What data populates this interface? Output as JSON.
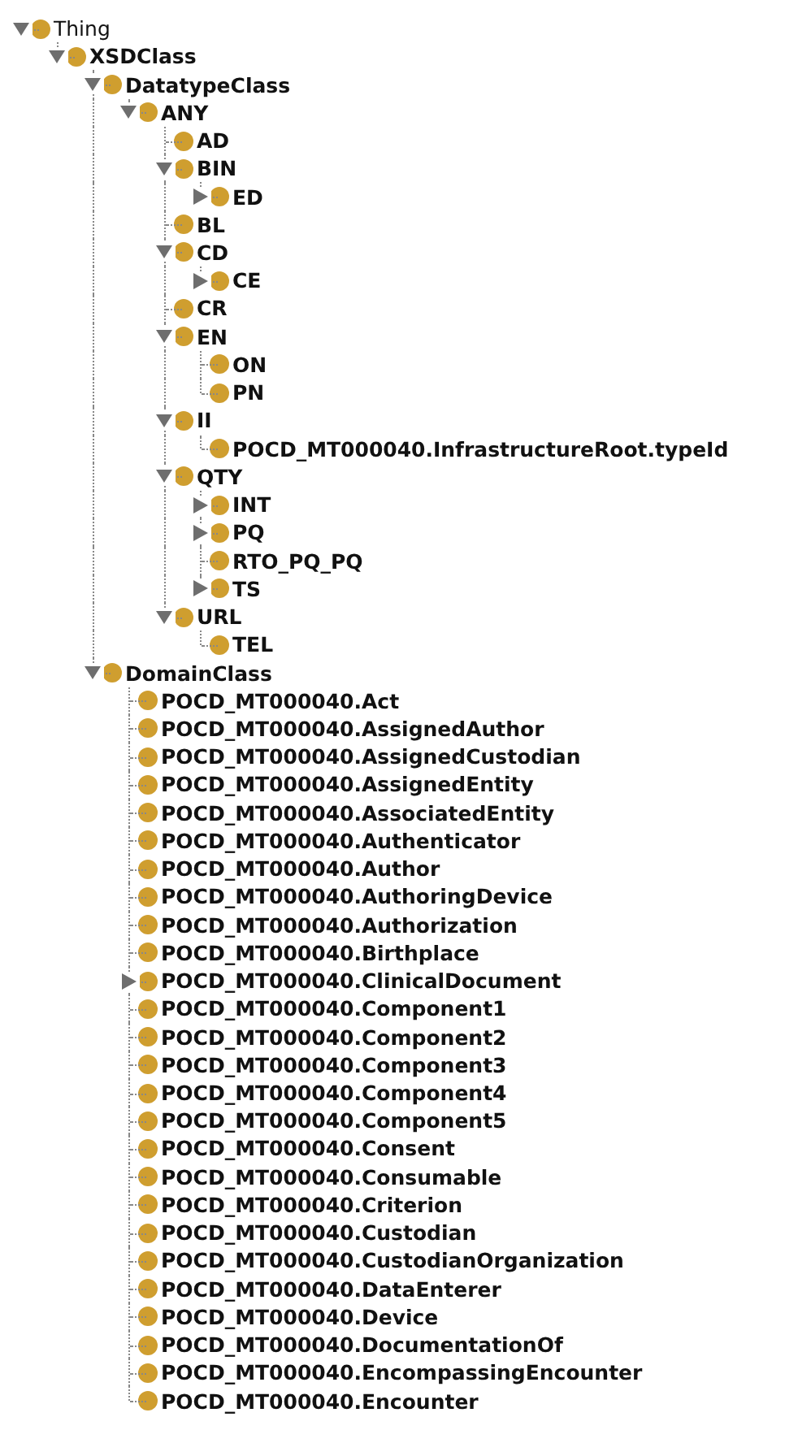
{
  "class_tree": [
    {
      "label": "Thing",
      "expanded": true,
      "children": [
        {
          "label": "XSDClass",
          "expanded": true,
          "children": [
            {
              "label": "DatatypeClass",
              "expanded": true,
              "children": [
                {
                  "label": "ANY",
                  "expanded": true,
                  "children": [
                    {
                      "label": "AD"
                    },
                    {
                      "label": "BIN",
                      "expanded": true,
                      "children": [
                        {
                          "label": "ED",
                          "expanded": false
                        }
                      ]
                    },
                    {
                      "label": "BL"
                    },
                    {
                      "label": "CD",
                      "expanded": true,
                      "children": [
                        {
                          "label": "CE",
                          "expanded": false
                        }
                      ]
                    },
                    {
                      "label": "CR"
                    },
                    {
                      "label": "EN",
                      "expanded": true,
                      "children": [
                        {
                          "label": "ON"
                        },
                        {
                          "label": "PN"
                        }
                      ]
                    },
                    {
                      "label": "II",
                      "expanded": true,
                      "children": [
                        {
                          "label": "POCD_MT000040.InfrastructureRoot.typeId"
                        }
                      ]
                    },
                    {
                      "label": "QTY",
                      "expanded": true,
                      "children": [
                        {
                          "label": "INT",
                          "expanded": false
                        },
                        {
                          "label": "PQ",
                          "expanded": false
                        },
                        {
                          "label": "RTO_PQ_PQ"
                        },
                        {
                          "label": "TS",
                          "expanded": false
                        }
                      ]
                    },
                    {
                      "label": "URL",
                      "expanded": true,
                      "children": [
                        {
                          "label": "TEL"
                        }
                      ]
                    }
                  ]
                }
              ]
            },
            {
              "label": "DomainClass",
              "expanded": true,
              "children": [
                {
                  "label": "POCD_MT000040.Act"
                },
                {
                  "label": "POCD_MT000040.AssignedAuthor"
                },
                {
                  "label": "POCD_MT000040.AssignedCustodian"
                },
                {
                  "label": "POCD_MT000040.AssignedEntity"
                },
                {
                  "label": "POCD_MT000040.AssociatedEntity"
                },
                {
                  "label": "POCD_MT000040.Authenticator"
                },
                {
                  "label": "POCD_MT000040.Author"
                },
                {
                  "label": "POCD_MT000040.AuthoringDevice"
                },
                {
                  "label": "POCD_MT000040.Authorization"
                },
                {
                  "label": "POCD_MT000040.Birthplace"
                },
                {
                  "label": "POCD_MT000040.ClinicalDocument",
                  "expanded": false
                },
                {
                  "label": "POCD_MT000040.Component1"
                },
                {
                  "label": "POCD_MT000040.Component2"
                },
                {
                  "label": "POCD_MT000040.Component3"
                },
                {
                  "label": "POCD_MT000040.Component4"
                },
                {
                  "label": "POCD_MT000040.Component5"
                },
                {
                  "label": "POCD_MT000040.Consent"
                },
                {
                  "label": "POCD_MT000040.Consumable"
                },
                {
                  "label": "POCD_MT000040.Criterion"
                },
                {
                  "label": "POCD_MT000040.Custodian"
                },
                {
                  "label": "POCD_MT000040.CustodianOrganization"
                },
                {
                  "label": "POCD_MT000040.DataEnterer"
                },
                {
                  "label": "POCD_MT000040.Device"
                },
                {
                  "label": "POCD_MT000040.DocumentationOf"
                },
                {
                  "label": "POCD_MT000040.EncompassingEncounter"
                },
                {
                  "label": "POCD_MT000040.Encounter"
                }
              ]
            }
          ]
        }
      ]
    }
  ]
}
